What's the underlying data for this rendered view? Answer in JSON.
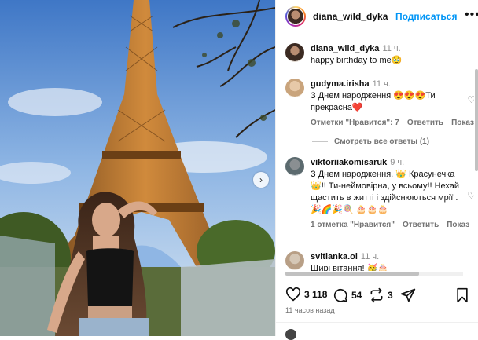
{
  "post": {
    "author": "diana_wild_dyka",
    "follow_label": "Подписаться",
    "more_label": "•••",
    "carousel_next": "›"
  },
  "caption": {
    "author": "diana_wild_dyka",
    "time": "11 ч.",
    "text": "happy birthday to me🥹"
  },
  "comments": [
    {
      "author": "gudyma.irisha",
      "time": "11 ч.",
      "text": "З Днем народження 😍😍😍Ти прекрасна❤️",
      "likes": "Отметки \"Нравится\": 7",
      "reply": "Ответить",
      "show": "Показ"
    },
    {
      "author": "viktoriiakomisaruk",
      "time": "9 ч.",
      "text": "З Днем народження, 👑 Красунечка👑!! Ти-неймовірна, у всьому!! Нехай щастить в житті і здійснюються мрії . 🎉🌈🎉🍭 🎂🎂🎂",
      "likes": "1 отметка \"Нравится\"",
      "reply": "Ответить",
      "show": "Показ"
    },
    {
      "author": "svitlanka.ol",
      "time": "11 ч.",
      "text": "Щирі вітання! 🥳🎂"
    }
  ],
  "view_replies": "Смотреть все ответы (1)",
  "actions": {
    "likes": "3 118",
    "comments": "54",
    "reposts": "3"
  },
  "time_ago": "11 часов назад",
  "icons": {
    "like": "heart-icon",
    "comment": "comment-icon",
    "repost": "repost-icon",
    "share": "send-icon",
    "save": "bookmark-icon"
  }
}
